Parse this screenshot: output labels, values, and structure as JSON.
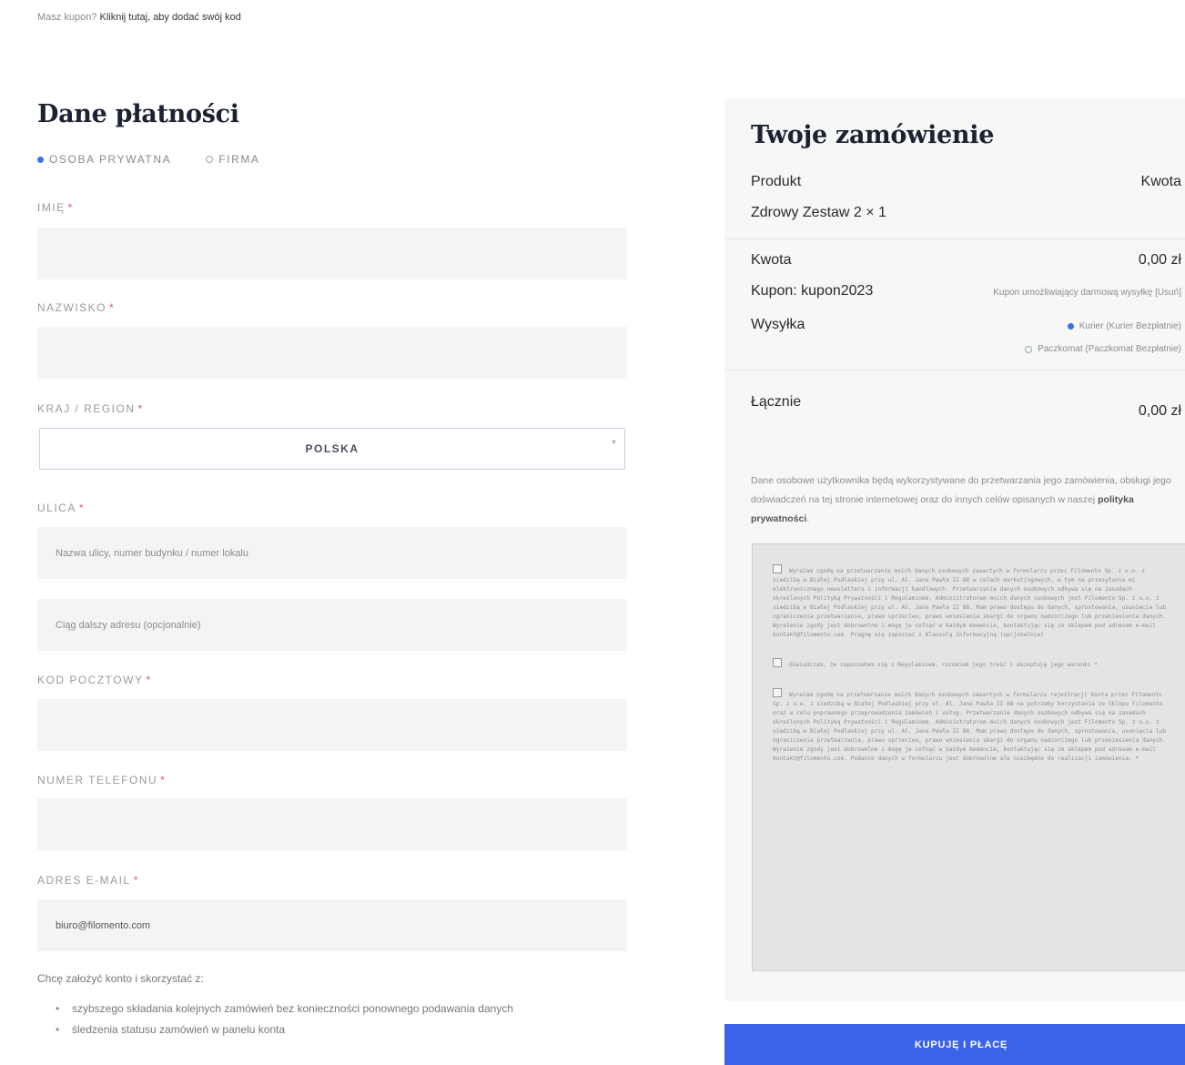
{
  "coupon": {
    "prefix": "Masz kupon?",
    "link": "Kliknij tutaj, aby dodać swój kod"
  },
  "billing": {
    "title": "Dane płatności",
    "customer_types": [
      {
        "label": "OSOBA PRYWATNA",
        "selected": true
      },
      {
        "label": "FIRMA",
        "selected": false
      }
    ],
    "fields": {
      "first_name": {
        "label": "IMIĘ",
        "value": ""
      },
      "last_name": {
        "label": "NAZWISKO",
        "value": ""
      },
      "country": {
        "label": "KRAJ / REGION",
        "value": "POLSKA"
      },
      "street": {
        "label": "ULICA",
        "placeholder1": "Nazwa ulicy, numer budynku / numer lokalu",
        "placeholder2": "Ciąg dalszy adresu (opcjonalnie)"
      },
      "postcode": {
        "label": "KOD POCZTOWY",
        "value": ""
      },
      "phone": {
        "label": "NUMER TELEFONU",
        "value": ""
      },
      "email": {
        "label": "ADRES E-MAIL",
        "value": "biuro@filomento.com"
      }
    },
    "required_marker": "*",
    "account_note": "Chcę założyć konto i skorzystać z:",
    "benefits": [
      "szybszego składania kolejnych zamówień bez konieczności ponownego podawania danych",
      "śledzenia statusu zamówień w panelu konta"
    ]
  },
  "order": {
    "title": "Twoje zamówienie",
    "col_product": "Produkt",
    "col_amount": "Kwota",
    "item": {
      "name": "Zdrowy Zestaw 2",
      "qty": "× 1"
    },
    "subtotal_label": "Kwota",
    "subtotal_value": "0,00 zł",
    "coupon_label": "Kupon: kupon2023",
    "coupon_value": "Kupon umożliwiający darmową wysyłkę [Usuń]",
    "shipping_label": "Wysyłka",
    "shipping_options": [
      {
        "label": "Kurier (Kurier Bezpłatnie)",
        "selected": true
      },
      {
        "label": "Paczkomat (Paczkomat Bezpłatnie)",
        "selected": false
      }
    ],
    "total_label": "Łącznie",
    "total_value": "0,00 zł",
    "privacy_text": "Dane osobowe użytkownika będą wykorzystywane do przetwarzania jego zamówienia, obsługi jego doświadczeń na tej stronie internetowej oraz do innych celów opisanych w naszej",
    "privacy_link": "polityka prywatności",
    "privacy_end": ".",
    "consents": [
      {
        "text": "Wyrażam zgodę na przetwarzanie moich danych osobowych zawartych w formularzu przez Filomento Sp. z o.o. z siedzibą w Białej Podlaskiej przy ul. Al. Jana Pawła II 88 w celach marketingowych, w tym na przesyłanie mi elektronicznego newslettera i informacji handlowych. Przetwarzanie danych osobowych odbywa się na zasadach określonych Polityką Prywatności i Regulaminem. Administratorem moich danych osobowych jest Filomento Sp. z o.o. z siedzibą w Białej Podlaskiej przy ul. Al. Jana Pawła II 88. Mam prawo dostępu do danych, sprostowania, usunięcia lub ograniczenia przetwarzania, prawo sprzeciwu, prawo wniesienia skargi do organu nadzorczego lub przeniesienia danych. Wyrażenie zgody jest dobrowolne i mogę je cofnąć w każdym momencie, kontaktując się ze sklepem pod adresem e-mail kontakt@filomento.com. Pragnę się zapoznać z Klauzulą Informacyjną (opcjonalnie)"
      },
      {
        "text": "Oświadczam, że zapoznałem się z Regulaminem, rozumiem jego treść i akceptuję jego warunki *"
      },
      {
        "text": "Wyrażam zgodę na przetwarzanie moich danych osobowych zawartych w formularzu rejestracji konta przez Filomento Sp. z o.o. z siedzibą w Białej Podlaskiej przy ul. Al. Jana Pawła II 88 na potrzeby korzystania ze Sklepu Filomento oraz w celu poprawnego przeprowadzenia zamówień i usług. Przetwarzanie danych osobowych odbywa się na zasadach określonych Polityką Prywatności i Regulaminem. Administratorem moich danych osobowych jest Filomento Sp. z o.o. z siedzibą w Białej Podlaskiej przy ul. Al. Jana Pawła II 88. Mam prawo dostępu do danych, sprostowania, usunięcia lub ograniczenia przetwarzania, prawo sprzeciwu, prawo wniesienia skargi do organu nadzorczego lub przeniesienia danych. Wyrażenie zgody jest dobrowolne i mogę je cofnąć w każdym momencie, kontaktując się ze sklepem pod adresem e-mail kontakt@filomento.com. Podanie danych w formularzu jest dobrowolne ale niezbędne do realizacji zamówienia. *"
      }
    ],
    "buy_button": "KUPUJĘ I PŁACĘ"
  },
  "colors": {
    "accent": "#3a63e9",
    "required": "#e05a5a",
    "title": "#1c2231"
  }
}
